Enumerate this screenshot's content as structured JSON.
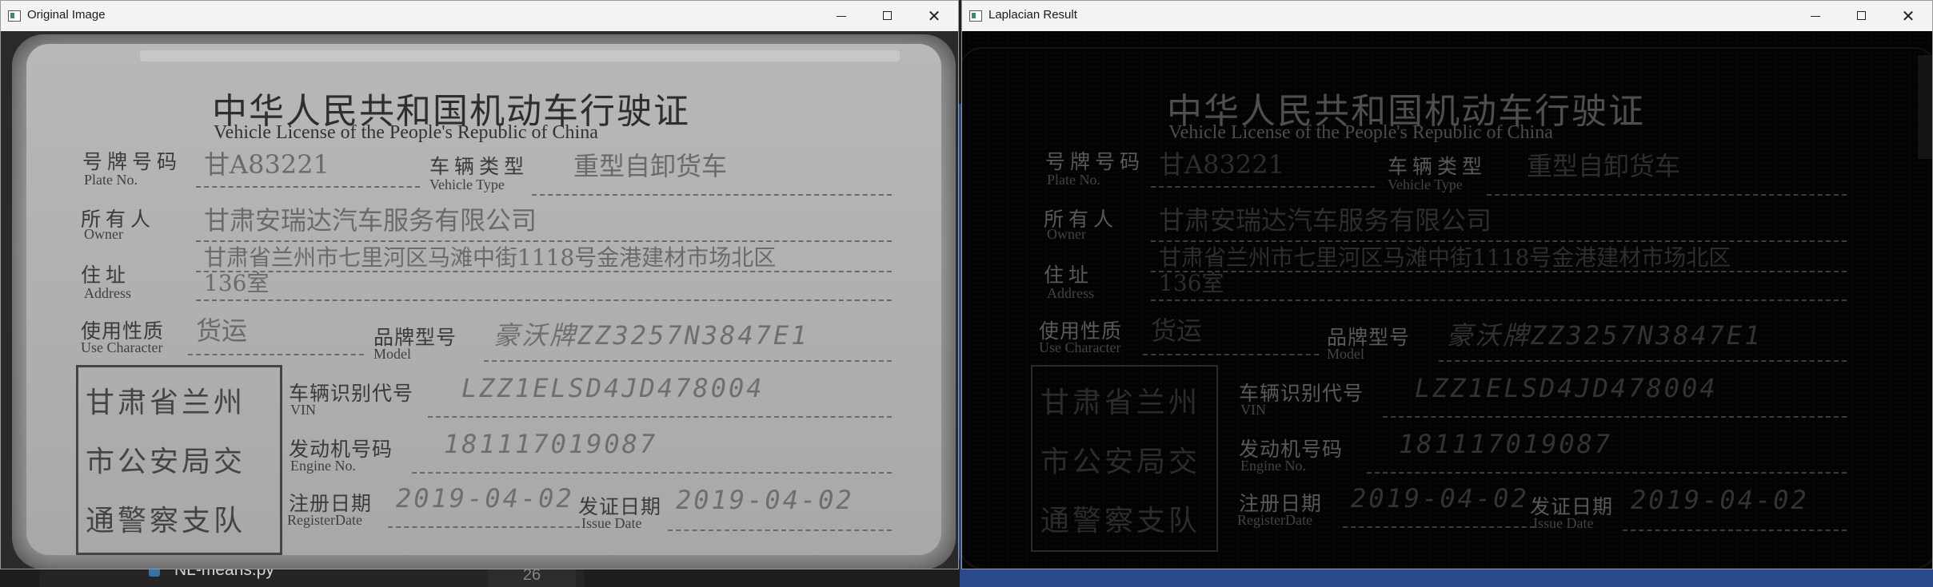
{
  "background": {
    "ide_file_name": "NL-means.py",
    "ide_line_number": "26"
  },
  "windows": [
    {
      "title": "Original Image",
      "controls": {
        "minimize": "",
        "maximize": "",
        "close": "✕"
      }
    },
    {
      "title": "Laplacian Result",
      "controls": {
        "minimize": "",
        "maximize": "",
        "close": "✕"
      }
    }
  ],
  "license": {
    "title_cn": "中华人民共和国机动车行驶证",
    "title_en": "Vehicle License of the People's Republic of China",
    "plate_label_cn": "号牌号码",
    "plate_label_en": "Plate No.",
    "plate_value": "甘A83221",
    "vehicle_type_label_cn": "车辆类型",
    "vehicle_type_label_en": "Vehicle Type",
    "vehicle_type_value": "重型自卸货车",
    "owner_label_cn": "所有人",
    "owner_label_en": "Owner",
    "owner_value": "甘肃安瑞达汽车服务有限公司",
    "address_label_cn": "住址",
    "address_label_en": "Address",
    "address_value_line1": "甘肃省兰州市七里河区马滩中街1118号金港建材市场北区",
    "address_value_line2": "136室",
    "use_label_cn": "使用性质",
    "use_label_en": "Use Character",
    "use_value": "货运",
    "model_label_cn": "品牌型号",
    "model_label_en": "Model",
    "model_value": "豪沃牌ZZ3257N3847E1",
    "vin_label_cn": "车辆识别代号",
    "vin_label_en": "VIN",
    "vin_value": "LZZ1ELSD4JD478004",
    "engine_label_cn": "发动机号码",
    "engine_label_en": "Engine No.",
    "engine_value": "181117019087",
    "register_label_cn": "注册日期",
    "register_label_en": "RegisterDate",
    "register_value": "2019-04-02",
    "issue_label_cn": "发证日期",
    "issue_label_en": "Issue Date",
    "issue_value": "2019-04-02",
    "stamp_lines": [
      "甘肃省兰州",
      "市公安局交",
      "通警察支队"
    ]
  }
}
